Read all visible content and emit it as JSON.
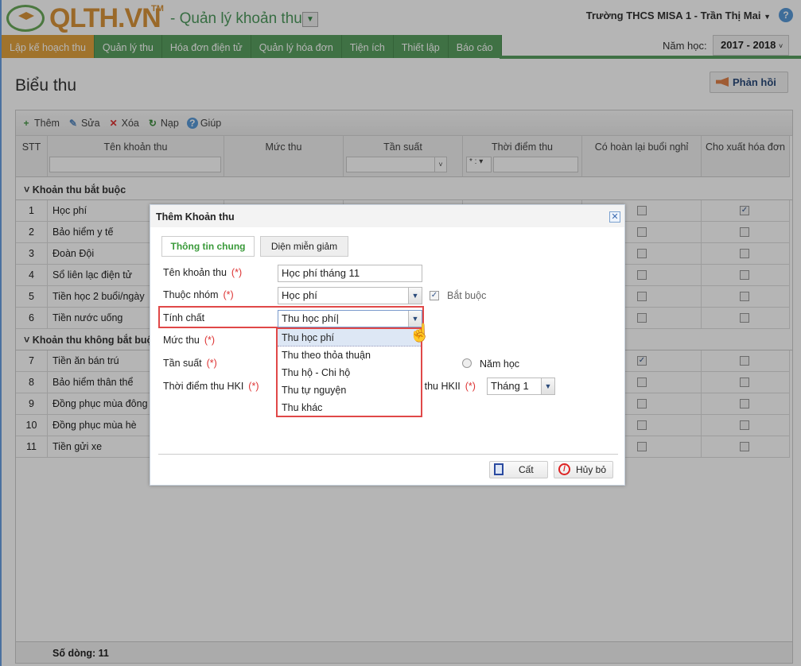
{
  "header": {
    "logo": "QLTH.VN",
    "logo_tm": "TM",
    "app_subtitle": "- Quản lý khoản thu",
    "user": "Trường THCS MISA 1 - Trần Thị Mai",
    "nav": [
      "Lập kế hoạch thu",
      "Quản lý thu",
      "Hóa đơn điện tử",
      "Quản lý hóa đơn",
      "Tiện ích",
      "Thiết lập",
      "Báo cáo"
    ],
    "year_label": "Năm học:",
    "year_value": "2017 - 2018"
  },
  "page": {
    "title": "Biểu thu",
    "feedback": "Phản hồi"
  },
  "toolbar": {
    "add": "Thêm",
    "edit": "Sửa",
    "delete": "Xóa",
    "reload": "Nạp",
    "help": "Giúp"
  },
  "grid": {
    "columns": [
      "STT",
      "Tên khoản thu",
      "Mức thu",
      "Tần suất",
      "Thời điểm thu",
      "Có hoàn lại buổi nghỉ",
      "Cho xuất hóa đơn"
    ],
    "time_filter_op": "* :",
    "groups": [
      {
        "name": "Khoản thu bắt buộc",
        "rows": [
          {
            "stt": "1",
            "name": "Học phí",
            "refund": false,
            "invoice": true
          },
          {
            "stt": "2",
            "name": "Bảo hiểm y tế",
            "refund": false,
            "invoice": false
          },
          {
            "stt": "3",
            "name": "Đoàn Đội",
            "refund": false,
            "invoice": false
          },
          {
            "stt": "4",
            "name": "Sổ liên lạc điện tử",
            "refund": false,
            "invoice": false
          },
          {
            "stt": "5",
            "name": "Tiền học 2 buổi/ngày",
            "refund": false,
            "invoice": false
          },
          {
            "stt": "6",
            "name": "Tiền nước uống",
            "refund": false,
            "invoice": false
          }
        ]
      },
      {
        "name": "Khoản thu không bắt buộc",
        "rows": [
          {
            "stt": "7",
            "name": "Tiền ăn bán trú",
            "refund": true,
            "invoice": false
          },
          {
            "stt": "8",
            "name": "Bảo hiểm thân thể",
            "refund": false,
            "invoice": false
          },
          {
            "stt": "9",
            "name": "Đồng phục mùa đông",
            "refund": false,
            "invoice": false
          },
          {
            "stt": "10",
            "name": "Đồng phục mùa hè",
            "refund": false,
            "invoice": false
          },
          {
            "stt": "11",
            "name": "Tiền gửi xe",
            "refund": false,
            "invoice": false
          }
        ]
      }
    ],
    "footer": "Số dòng: 11"
  },
  "dialog": {
    "title": "Thêm Khoản thu",
    "tabs": [
      "Thông tin chung",
      "Diện miễn giảm"
    ],
    "required_mark": "(*)",
    "fields": {
      "name_label": "Tên khoản thu",
      "name_value": "Học phí tháng 11",
      "group_label": "Thuộc nhóm",
      "group_value": "Học phí",
      "mandatory_label": "Bắt buộc",
      "nature_label": "Tính chất",
      "nature_value": "Thu học phí",
      "amount_label": "Mức thu",
      "freq_label": "Tần suất",
      "freq_year": "Năm học",
      "hk1_label": "Thời điểm thu HKI",
      "hk2_label": "Thời điểm thu HKII",
      "hk2_value": "Tháng 1"
    },
    "nature_options": [
      "Thu học phí",
      "Thu theo thỏa thuận",
      "Thu hộ - Chi hộ",
      "Thu tự nguyện",
      "Thu khác"
    ],
    "save": "Cất",
    "cancel": "Hủy bỏ"
  },
  "colors": {
    "nav_green": "#5aa060",
    "nav_active": "#e2a23f",
    "highlight": "#e04848"
  }
}
